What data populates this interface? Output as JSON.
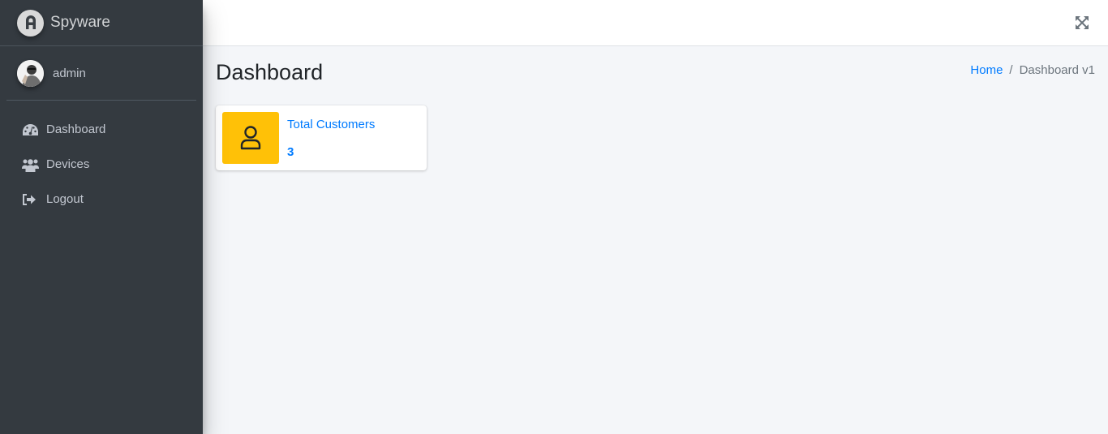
{
  "app": {
    "brand_name": "Spyware",
    "brand_logo_icon": "brand-logo-icon"
  },
  "user": {
    "name": "admin",
    "avatar_icon": "user-avatar"
  },
  "sidebar": {
    "items": [
      {
        "label": "Dashboard",
        "icon": "tachometer-icon"
      },
      {
        "label": "Devices",
        "icon": "users-icon"
      },
      {
        "label": "Logout",
        "icon": "sign-out-icon"
      }
    ]
  },
  "topbar": {
    "fullscreen_icon": "expand-arrows-icon"
  },
  "page": {
    "title": "Dashboard",
    "breadcrumb": {
      "home": "Home",
      "separator": "/",
      "current": "Dashboard v1"
    }
  },
  "stats": {
    "total_customers": {
      "label": "Total Customers",
      "value": "3",
      "icon": "user-icon",
      "color": "#ffc107"
    }
  },
  "colors": {
    "sidebar_bg": "#343a40",
    "accent": "#007bff",
    "warning": "#ffc107",
    "content_bg": "#f4f6f9"
  }
}
